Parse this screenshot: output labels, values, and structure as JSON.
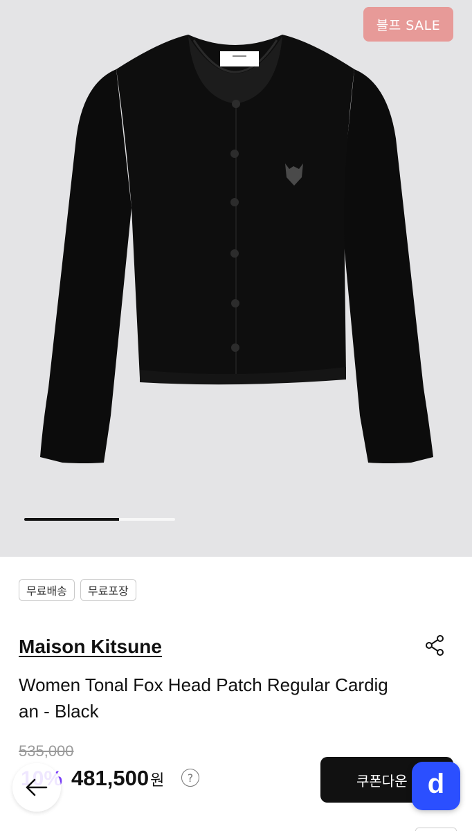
{
  "hero": {
    "badge_label": "블프 SALE",
    "image_progress": 0.63
  },
  "tags": [
    "무료배송",
    "무료포장"
  ],
  "product": {
    "brand": "Maison Kitsune",
    "name": "Women Tonal Fox Head Patch Regular Cardigan - Black",
    "original_price": "535,000",
    "discount": "10%",
    "price": "481,500",
    "price_unit": "원",
    "help_symbol": "?"
  },
  "actions": {
    "coupon_label": "쿠폰다운",
    "app_label": "d"
  },
  "icons": {
    "share": "share-icon",
    "back": "arrow-left-icon"
  },
  "colors": {
    "badge": "#e79a98",
    "discount": "#7a3cff",
    "app_button": "#2b4fff",
    "hero_bg": "#e4e4e6"
  }
}
